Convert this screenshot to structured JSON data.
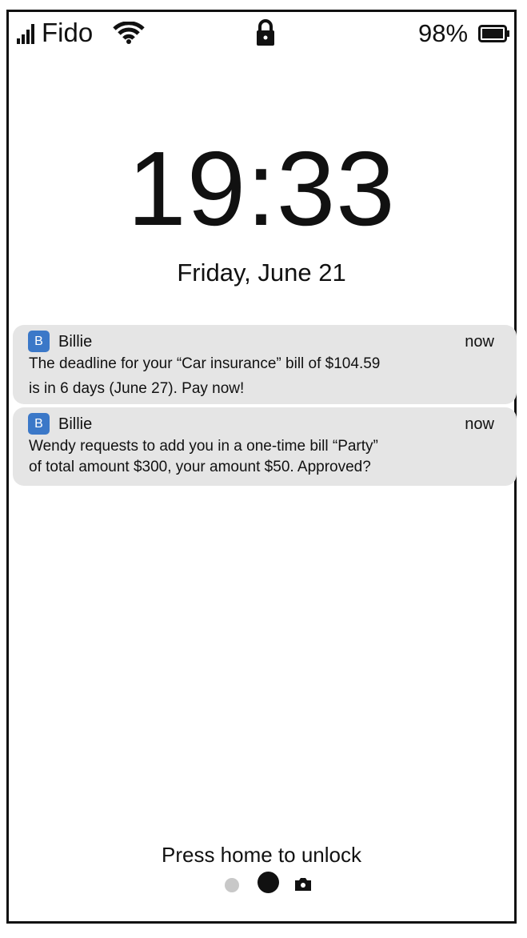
{
  "status_bar": {
    "carrier": "Fido",
    "battery_percent": "98%",
    "icons": [
      "signal-icon",
      "wifi-icon",
      "lock-icon",
      "battery-icon"
    ]
  },
  "lock_screen": {
    "time": "19:33",
    "date": "Friday, June 21"
  },
  "notifications": [
    {
      "app_name": "Billie",
      "app_icon_letter": "B",
      "time": "now",
      "lines": [
        "The deadline for your “Car insurance” bill of $104.59",
        "is in 6 days (June 27). Pay now!"
      ]
    },
    {
      "app_name": "Billie",
      "app_icon_letter": "B",
      "time": "now",
      "lines": [
        "Wendy requests to add you in a one-time bill “Party”",
        "of total amount $300, your amount $50. Approved?"
      ]
    }
  ],
  "bottom": {
    "unlock_hint": "Press home to unlock",
    "page_indicator_icons": [
      "page-dot-icon",
      "page-dot-active-icon",
      "camera-icon"
    ]
  },
  "colors": {
    "notification_bg": "#e5e5e5",
    "app_icon_bg": "#3b78c8",
    "inactive_dot": "#c8c8c8"
  }
}
